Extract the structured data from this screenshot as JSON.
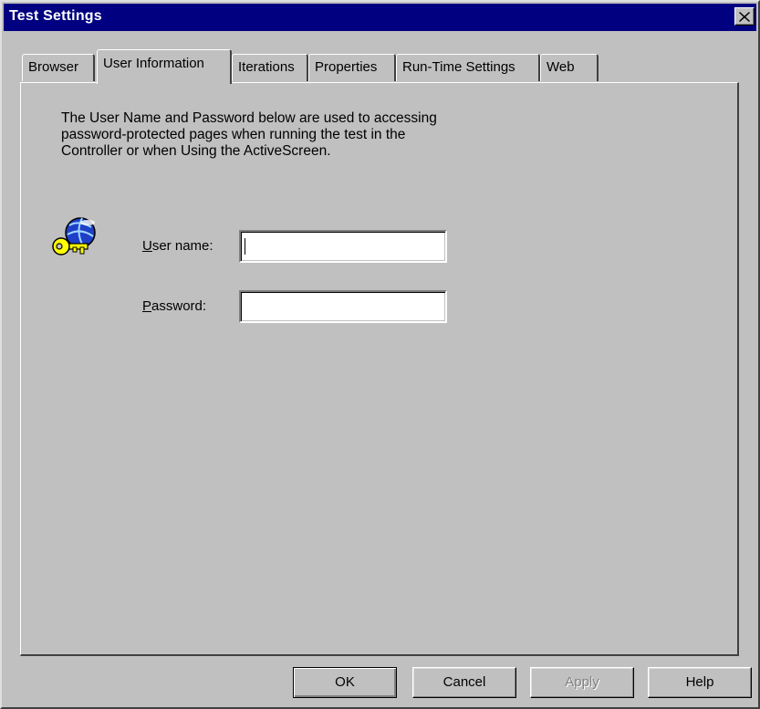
{
  "window": {
    "title": "Test Settings",
    "close_glyph": "✕"
  },
  "tabs": [
    {
      "label": "Browser",
      "active": false
    },
    {
      "label": "User Information",
      "active": true
    },
    {
      "label": "Iterations",
      "active": false
    },
    {
      "label": "Properties",
      "active": false
    },
    {
      "label": "Run-Time Settings",
      "active": false
    },
    {
      "label": "Web",
      "active": false
    }
  ],
  "panel": {
    "description": "The User Name and Password below are used to accessing\npassword-protected pages when running the test in the\nController or when Using the ActiveScreen.",
    "icon": "globe-key-icon",
    "username": {
      "mnemonic": "U",
      "label_rest": "ser name:",
      "value": ""
    },
    "password": {
      "mnemonic": "P",
      "label_rest": "assword:",
      "value": ""
    }
  },
  "buttons": {
    "ok": "OK",
    "cancel": "Cancel",
    "apply": "Apply",
    "help": "Help"
  },
  "colors": {
    "titlebar": "#000080",
    "face": "#c0c0c0"
  }
}
